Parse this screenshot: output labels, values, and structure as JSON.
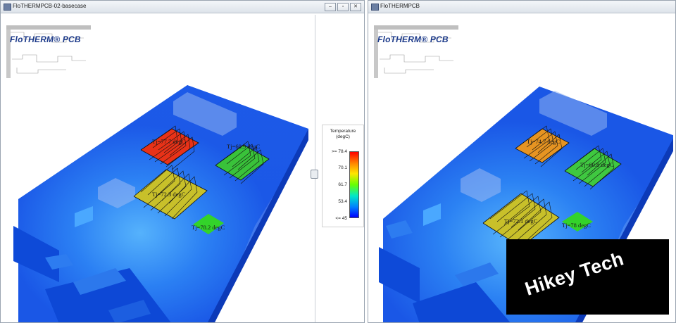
{
  "left_window": {
    "title": "FloTHERMPCB-02-basecase",
    "buttons": {
      "minimize": "‒",
      "restore": "▫",
      "close": "✕"
    },
    "logo": "FloTHERM® PCB",
    "labels": {
      "hs_top_left": "Tj=77.7 degC",
      "hs_top_right": "Tj=60.9 degC",
      "hs_bottom": "Tj=72.3 degC",
      "chip": "Tj=78.2 degC"
    },
    "heatsink_colors": {
      "top_left": "#e83218",
      "top_right": "#39c23a",
      "bottom": "#c8c02a",
      "chip": "#33d32a"
    }
  },
  "legend": {
    "title_line1": "Temperature",
    "title_line2": "(degC)",
    "labels": [
      ">= 78.4",
      "70.1",
      "61.7",
      "53.4",
      "<= 45"
    ]
  },
  "right_window": {
    "title": "FloTHERMPCB",
    "logo": "FloTHERM® PCB",
    "labels": {
      "hs_top_left": "Tj=74.7 degC",
      "hs_top_right": "Tj=60.8 degC",
      "hs_bottom": "Tj=72.1 degC",
      "chip": "Tj=78 degC"
    },
    "heatsink_colors": {
      "top_left": "#e69422",
      "top_right": "#3fc840",
      "bottom": "#c8c02a",
      "chip": "#33d32a"
    }
  },
  "watermark": {
    "text": "Hikey Tech"
  },
  "colors": {
    "board_blue": "#1e5fe0",
    "board_light": "#3aa0ff",
    "substrate": "#0a3fe0"
  }
}
